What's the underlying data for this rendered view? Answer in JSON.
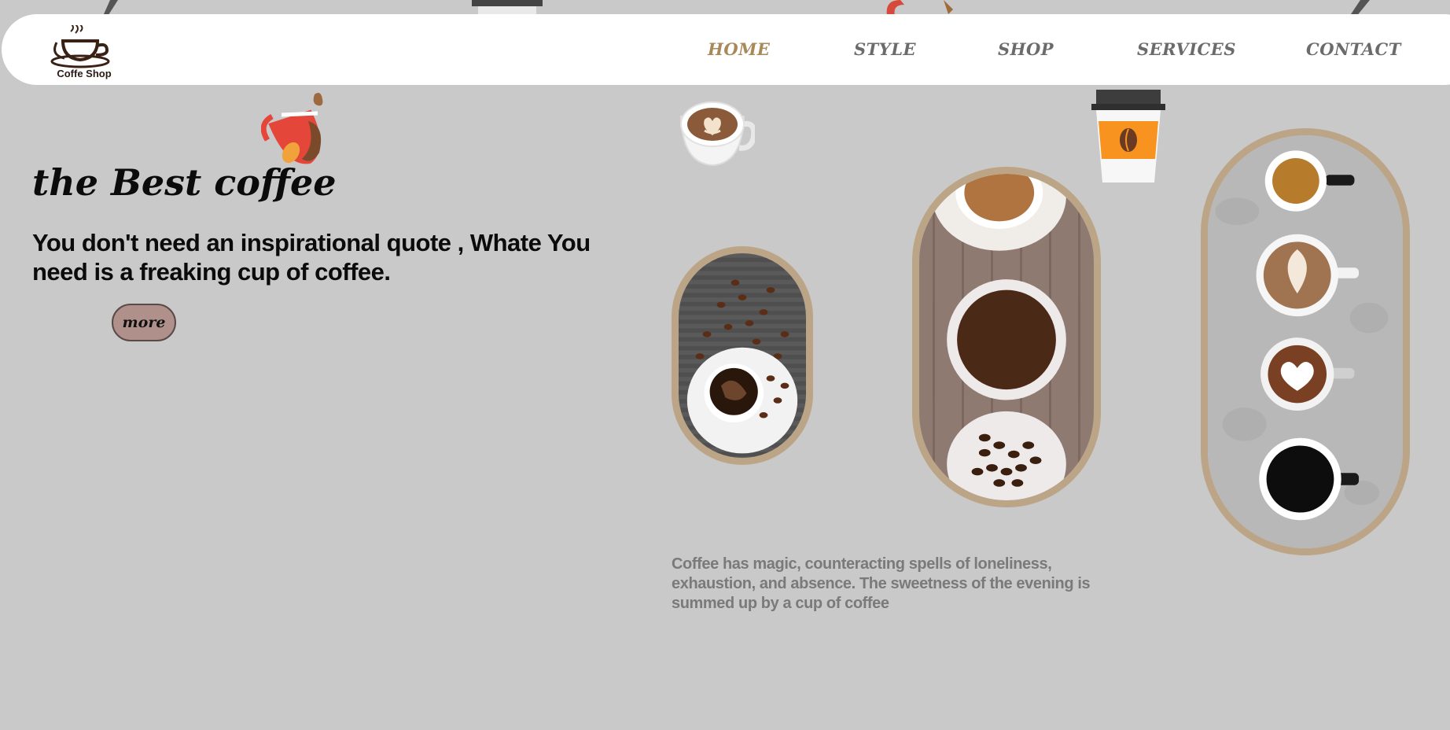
{
  "brand": {
    "name": "Coffe Shop"
  },
  "nav": {
    "items": [
      {
        "label": "HOME",
        "active": true
      },
      {
        "label": "STYLE",
        "active": false
      },
      {
        "label": "SHOP",
        "active": false
      },
      {
        "label": "SERVICES",
        "active": false
      },
      {
        "label": "CONTACT",
        "active": false
      }
    ]
  },
  "hero": {
    "title": "the Best coffee",
    "subtitle": "You don't need an inspirational quote , Whate You need is a freaking cup of coffee.",
    "button_label": "more"
  },
  "quote": {
    "text": "Coffee has magic, counteracting spells of loneliness, exhaustion, and absence. The sweetness of the evening is summed up by a cup of coffee"
  },
  "colors": {
    "background": "#c9c9c9",
    "navbar": "#ffffff",
    "accent": "#a8895a",
    "frame": "#bca587",
    "button": "#b0908a"
  },
  "icons": [
    "coffee-logo-icon",
    "spilling-cup-icon",
    "latte-cup-icon",
    "takeaway-cup-icon"
  ]
}
